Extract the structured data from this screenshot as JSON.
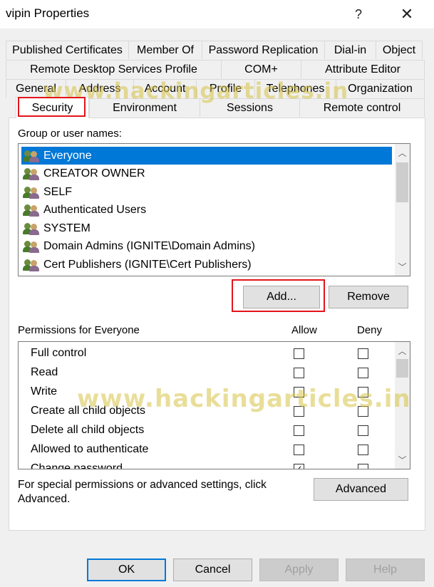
{
  "window": {
    "title": "vipin Properties",
    "help_glyph": "?",
    "close_glyph": "✕"
  },
  "tabs": {
    "row1": [
      "Published Certificates",
      "Member Of",
      "Password Replication",
      "Dial-in",
      "Object"
    ],
    "row2": [
      "Remote Desktop Services Profile",
      "COM+",
      "Attribute Editor"
    ],
    "row3": [
      "General",
      "Address",
      "Account",
      "Profile",
      "Telephones",
      "Organization"
    ],
    "row4": [
      "Security",
      "Environment",
      "Sessions",
      "Remote control"
    ],
    "active": "Security"
  },
  "groups": {
    "label": "Group or user names:",
    "items": [
      {
        "name": "Everyone",
        "selected": true
      },
      {
        "name": "CREATOR OWNER",
        "selected": false
      },
      {
        "name": "SELF",
        "selected": false
      },
      {
        "name": "Authenticated Users",
        "selected": false
      },
      {
        "name": "SYSTEM",
        "selected": false
      },
      {
        "name": "Domain Admins (IGNITE\\Domain Admins)",
        "selected": false
      },
      {
        "name": "Cert Publishers (IGNITE\\Cert Publishers)",
        "selected": false
      }
    ],
    "icon": "users-group-icon"
  },
  "buttons": {
    "add": "Add...",
    "remove": "Remove",
    "advanced": "Advanced",
    "ok": "OK",
    "cancel": "Cancel",
    "apply": "Apply",
    "help": "Help"
  },
  "permissions": {
    "label": "Permissions for Everyone",
    "allow_header": "Allow",
    "deny_header": "Deny",
    "items": [
      {
        "name": "Full control",
        "allow": false,
        "deny": false
      },
      {
        "name": "Read",
        "allow": false,
        "deny": false
      },
      {
        "name": "Write",
        "allow": false,
        "deny": false
      },
      {
        "name": "Create all child objects",
        "allow": false,
        "deny": false
      },
      {
        "name": "Delete all child objects",
        "allow": false,
        "deny": false
      },
      {
        "name": "Allowed to authenticate",
        "allow": false,
        "deny": false
      },
      {
        "name": "Change password",
        "allow": true,
        "deny": false
      }
    ]
  },
  "special": {
    "line1": "For special permissions or advanced settings, click",
    "line2": "Advanced."
  },
  "watermark": "www.hackingarticles.in",
  "colors": {
    "selection": "#0078d7",
    "highlight_box": "#e3141b",
    "dialog_bg": "#f0f0f0"
  }
}
